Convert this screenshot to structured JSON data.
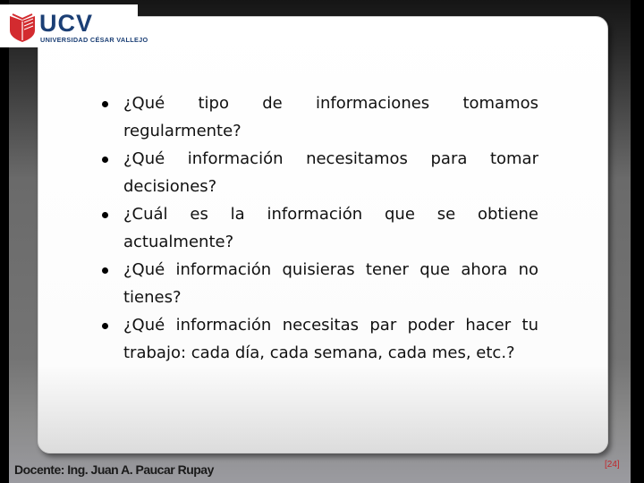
{
  "logo": {
    "name": "UCV",
    "subtitle": "UNIVERSIDAD CÉSAR VALLEJO",
    "brand_color": "#1b3f75",
    "shield_color": "#d32b2f"
  },
  "bullets": [
    "¿Qué tipo de informaciones tomamos regularmente?",
    "¿Qué información necesitamos para tomar decisiones?",
    "¿Cuál es la información que se obtiene actualmente?",
    "¿Qué información quisieras tener que ahora no tienes?",
    "¿Qué información necesitas par poder hacer tu trabajo: cada día, cada semana, cada mes, etc.?"
  ],
  "footer": {
    "docente": "Docente: Ing. Juan A. Paucar Rupay",
    "page_number": "[24]",
    "page_number_color": "#c0282d"
  }
}
